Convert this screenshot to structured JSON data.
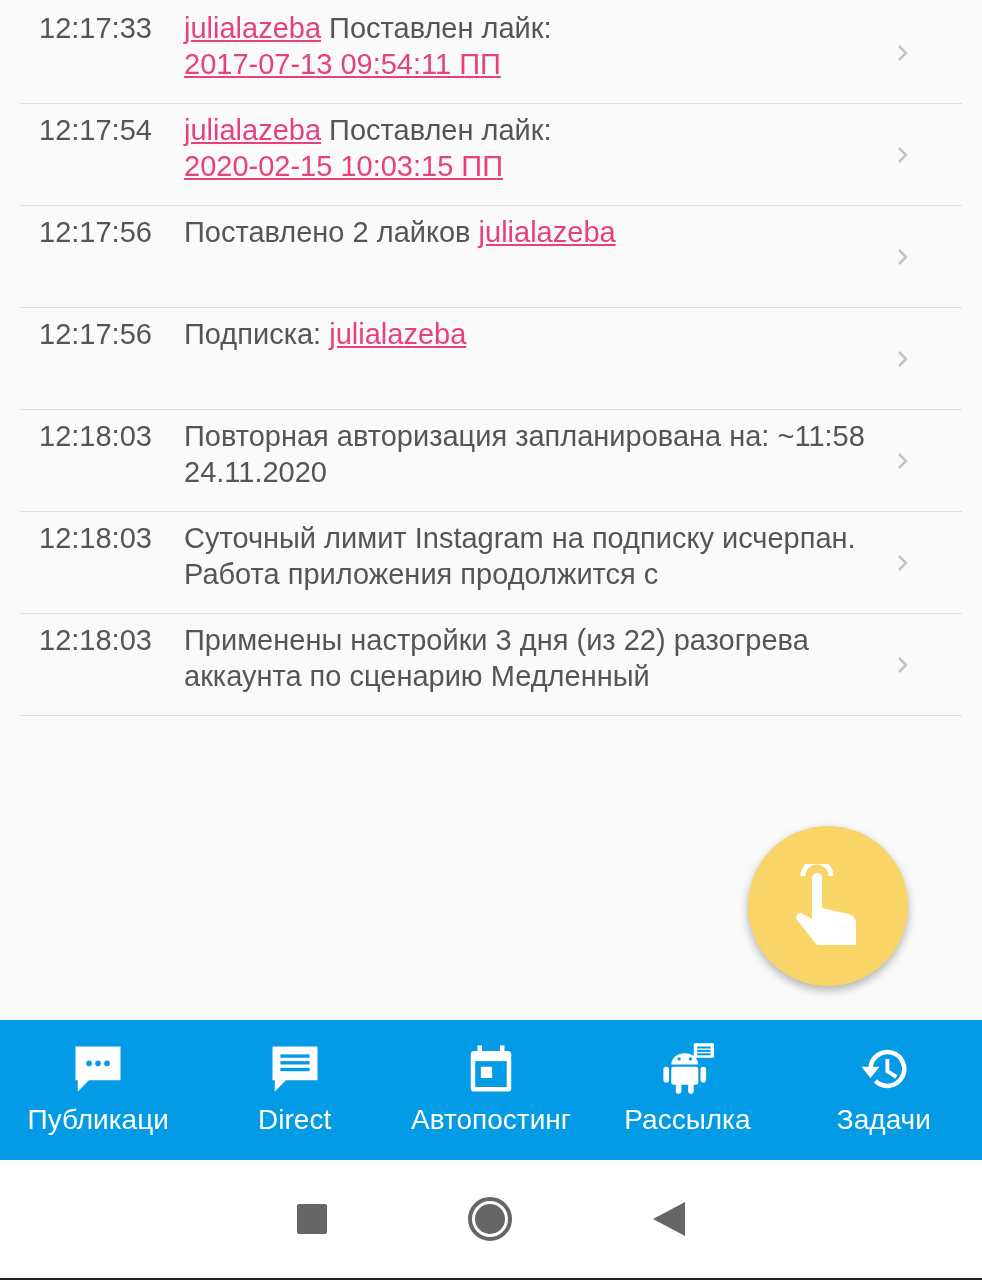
{
  "log": [
    {
      "time": "12:17:33",
      "parts": [
        {
          "kind": "link",
          "text": "julialazeba"
        },
        {
          "kind": "text",
          "text": " Поставлен лайк: "
        },
        {
          "kind": "link",
          "text": "2017-07-13 09:54:11 ПП"
        }
      ]
    },
    {
      "time": "12:17:54",
      "parts": [
        {
          "kind": "link",
          "text": "julialazeba"
        },
        {
          "kind": "text",
          "text": " Поставлен лайк: "
        },
        {
          "kind": "link",
          "text": "2020-02-15 10:03:15 ПП"
        }
      ]
    },
    {
      "time": "12:17:56",
      "parts": [
        {
          "kind": "text",
          "text": "Поставлено 2 лайков "
        },
        {
          "kind": "link",
          "text": "julialazeba"
        }
      ]
    },
    {
      "time": "12:17:56",
      "parts": [
        {
          "kind": "text",
          "text": "Подписка: "
        },
        {
          "kind": "link",
          "text": "julialazeba"
        }
      ]
    },
    {
      "time": "12:18:03",
      "parts": [
        {
          "kind": "text",
          "text": "Повторная авторизация запланирована на: ~11:58 24.11.2020"
        }
      ]
    },
    {
      "time": "12:18:03",
      "parts": [
        {
          "kind": "text",
          "text": "Суточный лимит Instagram на подписку исчерпан. Работа приложения продолжится с"
        }
      ]
    },
    {
      "time": "12:18:03",
      "parts": [
        {
          "kind": "text",
          "text": "Применены настройки 3 дня (из 22) разогрева аккаунта по сценарию Медленный"
        }
      ]
    }
  ],
  "bottom_nav": [
    {
      "kind": "posts",
      "label": "Публикаци"
    },
    {
      "kind": "direct",
      "label": "Direct"
    },
    {
      "kind": "autopost",
      "label": "Автопостинг"
    },
    {
      "kind": "mailing",
      "label": "Рассылка"
    },
    {
      "kind": "tasks",
      "label": "Задачи"
    }
  ]
}
